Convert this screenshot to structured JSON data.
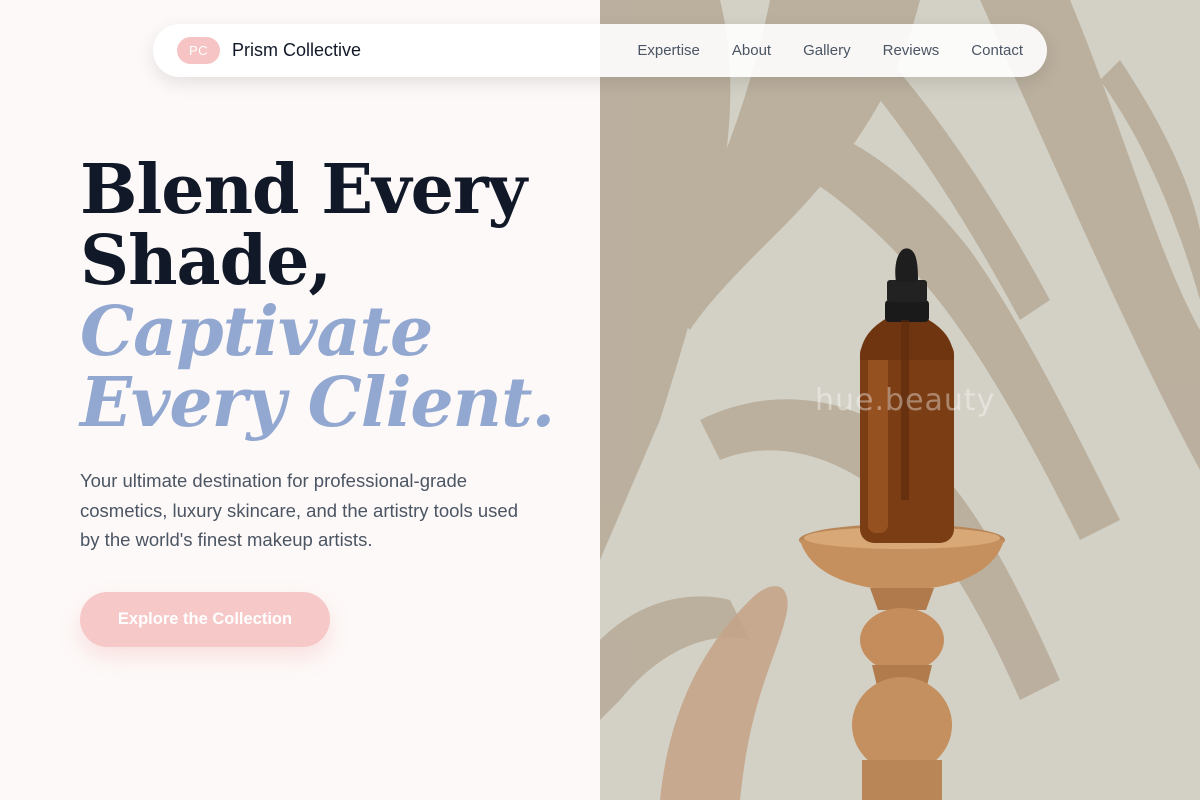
{
  "nav": {
    "logo_initials": "PC",
    "brand_name": "Prism Collective",
    "links": [
      "Expertise",
      "About",
      "Gallery",
      "Reviews",
      "Contact"
    ]
  },
  "hero": {
    "headline_lines": [
      "Blend Every",
      "Shade,"
    ],
    "accent_lines": [
      "Captivate",
      "Every Client."
    ],
    "lead": "Your ultimate destination for professional-grade cosmetics, luxury skincare, and the artistry tools used by the world's finest makeup artists.",
    "cta_label": "Explore the Collection",
    "image_watermark": "hue.beauty"
  },
  "colors": {
    "accent_blue": "#93a8d1",
    "accent_pink": "#f6c4c4",
    "heading": "#111827",
    "body_text": "#4b5563"
  },
  "icons": {
    "logo": "pc-logo-badge"
  }
}
